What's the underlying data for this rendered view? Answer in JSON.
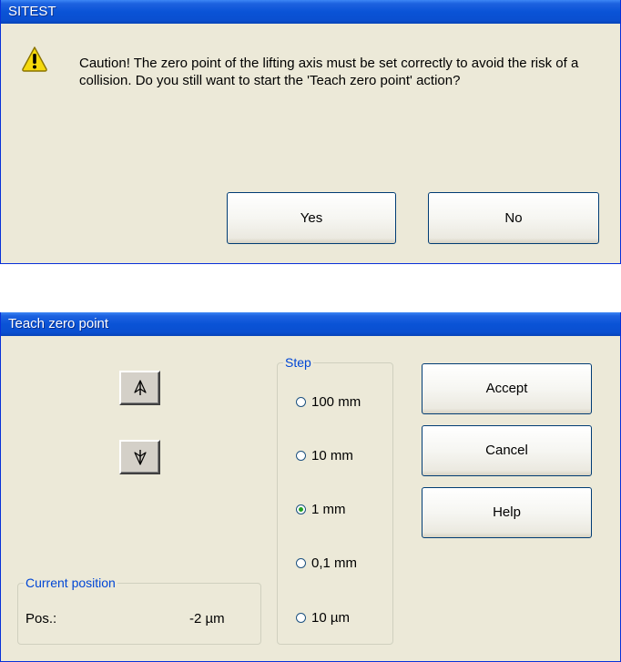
{
  "dialog_confirm": {
    "title": "SITEST",
    "message": "Caution! The zero point of the lifting axis must be set correctly to avoid the risk of a collision. Do you still want to start the 'Teach zero point' action?",
    "icon": "warning-icon",
    "yes_label": "Yes",
    "no_label": "No"
  },
  "dialog_teach": {
    "title": "Teach zero point",
    "up_icon": "arrow-up-icon",
    "down_icon": "arrow-down-icon",
    "step_group": {
      "label": "Step",
      "options": [
        {
          "label": "100 mm",
          "selected": false
        },
        {
          "label": "10 mm",
          "selected": false
        },
        {
          "label": "1 mm",
          "selected": true
        },
        {
          "label": "0,1 mm",
          "selected": false
        },
        {
          "label": "10 µm",
          "selected": false
        }
      ]
    },
    "position_group": {
      "label": "Current position",
      "pos_label": "Pos.:",
      "pos_value": "-2 µm"
    },
    "accept_label": "Accept",
    "cancel_label": "Cancel",
    "help_label": "Help"
  },
  "colors": {
    "titlebar": "#0a53d6",
    "window_bg": "#ece9d8",
    "group_label": "#0046d5",
    "radio_dot": "#21a121"
  }
}
